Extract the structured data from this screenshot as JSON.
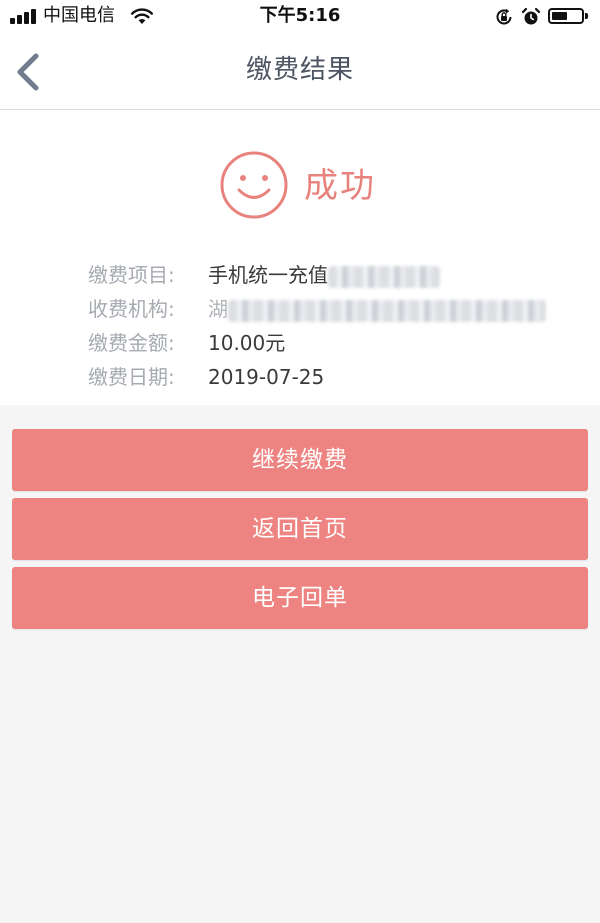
{
  "status_bar": {
    "carrier": "中国电信",
    "time": "下午5:16",
    "battery_level": 0.46
  },
  "nav": {
    "title": "缴费结果"
  },
  "result": {
    "status_text": "成功",
    "accent_color": "#e8827d",
    "items": [
      {
        "label": "缴费项目:",
        "value": "手机统一充值"
      },
      {
        "label": "收费机构:",
        "value": "湖"
      },
      {
        "label": "缴费金额:",
        "value": "10.00元"
      },
      {
        "label": "缴费日期:",
        "value": "2019-07-25"
      }
    ]
  },
  "actions": {
    "continue_label": "继续缴费",
    "home_label": "返回首页",
    "receipt_label": "电子回单",
    "button_color": "#ee8481"
  },
  "icons": {
    "back": "chevron-left-icon",
    "result": "smile-icon",
    "signal": "signal-icon",
    "wifi": "wifi-icon",
    "lock": "rotation-lock-icon",
    "alarm": "alarm-icon",
    "battery": "battery-icon"
  }
}
